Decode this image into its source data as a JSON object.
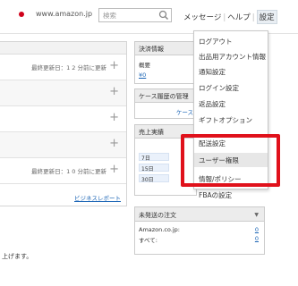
{
  "topbar": {
    "site": "www.amazon.jp",
    "search_placeholder": "検索",
    "nav": {
      "messages": "メッセージ",
      "help": "ヘルプ",
      "settings": "設定"
    }
  },
  "left_panel": {
    "rows": [
      {
        "text": "最終更新日：1 2 分前に更新"
      },
      {
        "text": ""
      },
      {
        "text": ""
      },
      {
        "text": ""
      },
      {
        "text": "最終更新日：1 0 分前に更新"
      }
    ],
    "report_link": "ビジネスレポート"
  },
  "payment": {
    "title": "決済情報",
    "label": "概要",
    "value": "¥0"
  },
  "case": {
    "title": "ケース履歴の管理",
    "link": "ケース"
  },
  "sales": {
    "title": "売上実績",
    "rows": [
      "7日",
      "15日",
      "30日"
    ]
  },
  "unshipped": {
    "title": "未発送の注文",
    "rows": [
      {
        "label": "Amazon.co.jp:",
        "value": "0"
      },
      {
        "label": "すべて:",
        "value": "0"
      }
    ]
  },
  "bottom_text": "上げます。",
  "menu": {
    "items": [
      "ログアウト",
      "出品用アカウント情報",
      "通知設定",
      "ログイン設定",
      "返品設定",
      "ギフトオプション",
      "配送設定",
      "ユーザー権限",
      "情報/ポリシー",
      "FBAの設定"
    ],
    "highlighted_index": 7
  },
  "colors": {
    "highlight_border": "#e0111b",
    "link": "#1a64b5"
  }
}
